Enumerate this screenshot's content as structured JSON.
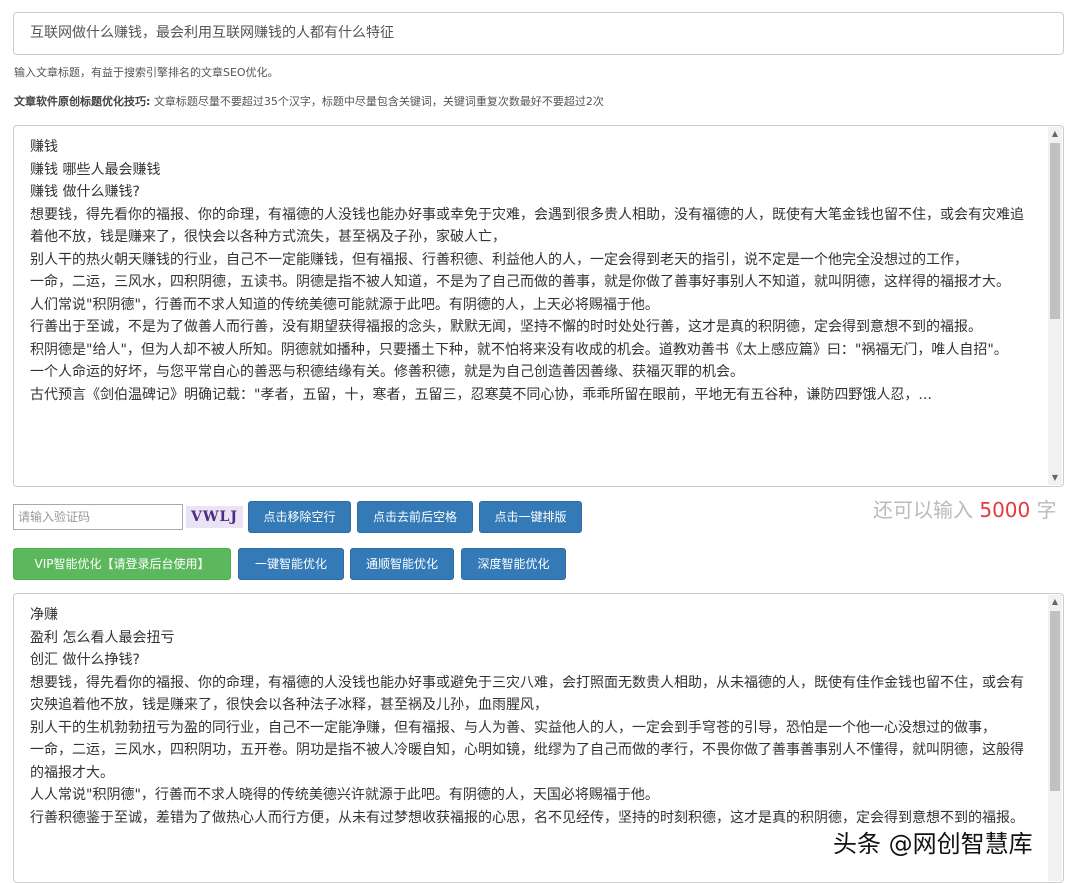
{
  "title_input": {
    "value": "互联网做什么赚钱，最会利用互联网赚钱的人都有什么特征"
  },
  "title_hint": "输入文章标题，有益于搜索引擎排名的文章SEO优化。",
  "tip": {
    "label": "文章软件原创标题优化技巧:",
    "text": "文章标题尽量不要超过35个汉字，标题中尽量包含关键词，关键词重复次数最好不要超过2次"
  },
  "source_text": {
    "lines": [
      "赚钱",
      "赚钱 哪些人最会赚钱",
      "赚钱 做什么赚钱?",
      "想要钱，得先看你的福报、你的命理，有福德的人没钱也能办好事或幸免于灾难，会遇到很多贵人相助，没有福德的人，既使有大笔金钱也留不住，或会有灾难追着他不放，钱是赚来了，很快会以各种方式流失，甚至祸及子孙，家破人亡，",
      "别人干的热火朝天赚钱的行业，自己不一定能赚钱，但有福报、行善积德、利益他人的人，一定会得到老天的指引，说不定是一个他完全没想过的工作，",
      "一命，二运，三风水，四积阴德，五读书。阴德是指不被人知道，不是为了自己而做的善事，就是你做了善事好事别人不知道，就叫阴德，这样得的福报才大。",
      "人们常说\"积阴德\"，行善而不求人知道的传统美德可能就源于此吧。有阴德的人，上天必将赐福于他。",
      "行善出于至诚，不是为了做善人而行善，没有期望获得福报的念头，默默无闻，坚持不懈的时时处处行善，这才是真的积阴德，定会得到意想不到的福报。",
      "积阴德是\"给人\"，但为人却不被人所知。阴德就如播种，只要播土下种，就不怕将来没有收成的机会。道教劝善书《太上感应篇》曰：\"祸福无门，唯人自招\"。",
      "一个人命运的好坏，与您平常自心的善恶与积德结缘有关。修善积德，就是为自己创造善因善缘、获福灭罪的机会。",
      "古代预言《剑伯温碑记》明确记载：\"孝者，五留，十，寒者，五留三，忍寒莫不同心协，乖乖所留在眼前，平地无有五谷种，谦防四野饿人忍，..."
    ]
  },
  "captcha": {
    "placeholder": "请输入验证码",
    "code": "VWLJ"
  },
  "buttons": {
    "remove_empty_lines": "点击移除空行",
    "trim_spaces": "点击去前后空格",
    "one_click_format": "点击一键排版",
    "vip_optimize": "VIP智能优化【请登录后台使用】",
    "one_click_optimize": "一键智能优化",
    "fluent_optimize": "通顺智能优化",
    "deep_optimize": "深度智能优化"
  },
  "counter": {
    "prefix": "还可以输入",
    "number": "5000",
    "suffix": "字"
  },
  "result_text": {
    "lines": [
      "净赚",
      "盈利 怎么看人最会扭亏",
      "创汇 做什么挣钱?",
      "想要钱，得先看你的福报、你的命理，有福德的人没钱也能办好事或避免于三灾八难，会打照面无数贵人相助，从未福德的人，既使有佳作金钱也留不住，或会有灾殃追着他不放，钱是赚来了，很快会以各种法子冰释，甚至祸及儿孙，血雨腥风，",
      "别人干的生机勃勃扭亏为盈的同行业，自己不一定能净赚，但有福报、与人为善、实益他人的人，一定会到手穹苍的引导，恐怕是一个他一心没想过的做事，",
      "一命，二运，三风水，四积阴功，五开卷。阴功是指不被人冷暖自知，心明如镜，纰缪为了自己而做的孝行，不畏你做了善事善事别人不懂得，就叫阴德，这般得的福报才大。",
      "人人常说\"积阴德\"，行善而不求人晓得的传统美德兴许就源于此吧。有阴德的人，天国必将赐福于他。",
      "行善积德鉴于至诚，差错为了做热心人而行方便，从未有过梦想收获福报的心思，名不见经传，坚持的时刻积德，这才是真的积阴德，定会得到意想不到的福报。"
    ]
  },
  "watermark": "头条 @网创智慧库"
}
